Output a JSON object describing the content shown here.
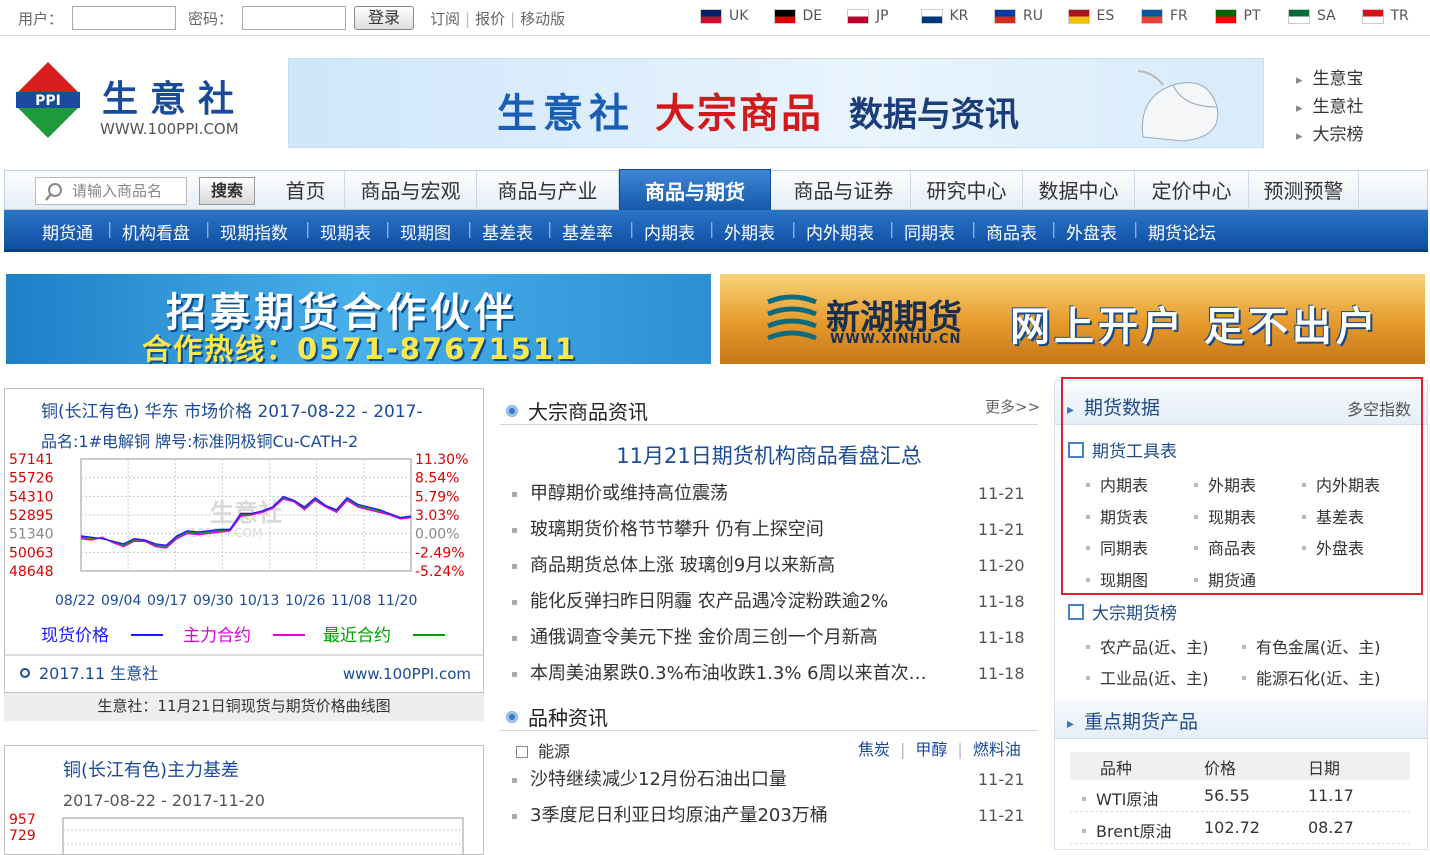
{
  "topbar": {
    "user_label": "用户：",
    "password_label": "密码：",
    "login_button": "登录",
    "links": [
      "订阅",
      "报价",
      "移动版"
    ],
    "languages": [
      {
        "code": "UK",
        "c1": "#012169",
        "c2": "#c8102e"
      },
      {
        "code": "DE",
        "c1": "#000000",
        "c2": "#dd0000"
      },
      {
        "code": "JP",
        "c1": "#ffffff",
        "c2": "#bc002d"
      },
      {
        "code": "KR",
        "c1": "#ffffff",
        "c2": "#003478"
      },
      {
        "code": "RU",
        "c1": "#0039a6",
        "c2": "#d52b1e"
      },
      {
        "code": "ES",
        "c1": "#aa151b",
        "c2": "#f1bf00"
      },
      {
        "code": "FR",
        "c1": "#0055a4",
        "c2": "#ef4135"
      },
      {
        "code": "PT",
        "c1": "#006600",
        "c2": "#ff0000"
      },
      {
        "code": "SA",
        "c1": "#006c35",
        "c2": "#ffffff"
      },
      {
        "code": "TR",
        "c1": "#e30a17",
        "c2": "#ffffff"
      }
    ]
  },
  "header": {
    "logo_text": "生意社",
    "logo_url": "WWW.100PPI.COM",
    "logo_badge": "PPI",
    "banner": {
      "part1": "生意社",
      "part2": "大宗商品",
      "part3": "数据与资讯"
    },
    "side_links": [
      "生意宝",
      "生意社",
      "大宗榜"
    ]
  },
  "nav": {
    "search_placeholder": "请输入商品名",
    "search_button": "搜索",
    "items": [
      "首页",
      "商品与宏观",
      "商品与产业",
      "商品与期货",
      "商品与证券",
      "研究中心",
      "数据中心",
      "定价中心",
      "预测预警"
    ],
    "active": "商品与期货",
    "subnav": [
      "期货通",
      "机构看盘",
      "现期指数",
      "现期表",
      "现期图",
      "基差表",
      "基差率",
      "内期表",
      "外期表",
      "内外期表",
      "同期表",
      "商品表",
      "外盘表",
      "期货论坛"
    ]
  },
  "ads": {
    "ad1_title": "招募期货合作伙伴",
    "ad1_phone": "合作热线：0571-87671511",
    "ad2_name": "新湖期货",
    "ad2_url": "WWW.XINHU.CN",
    "ad2_slogan": "网上开户 足不出户"
  },
  "left": {
    "chart1_caption": "生意社：11月21日铜现货与期货价格曲线图",
    "chart2_title": "铜(长江有色)主力基差",
    "chart2_range": "2017-08-22 - 2017-11-20",
    "chart2_ticks": [
      "957",
      "729"
    ]
  },
  "chart_data": {
    "type": "line",
    "title": "铜(长江有色) 华东 市场价格 2017-08-22 - 2017-",
    "subtitle": "品名:1#电解铜 牌号:标准阴极铜Cu-CATH-2",
    "y_ticks_left": [
      "57141",
      "55726",
      "54310",
      "52895",
      "51340",
      "50063",
      "48648"
    ],
    "y_ticks_right": [
      "11.30%",
      "8.54%",
      "5.79%",
      "3.03%",
      "0.00%",
      "-2.49%",
      "-5.24%"
    ],
    "x_ticks": [
      "08/22",
      "09/04",
      "09/17",
      "09/30",
      "10/13",
      "10/26",
      "11/08",
      "11/20"
    ],
    "ylim": [
      48648,
      57141
    ],
    "series": [
      {
        "name": "现货价格",
        "color": "#1a1aff",
        "values": [
          51300,
          51200,
          51100,
          50900,
          50700,
          51100,
          51000,
          50700,
          50600,
          51300,
          51700,
          51600,
          51700,
          51800,
          51800,
          53000,
          53000,
          53200,
          53500,
          54300,
          54000,
          53500,
          54200,
          53600,
          53300,
          54200,
          53700,
          53500,
          53300,
          53000,
          52700,
          52800
        ]
      },
      {
        "name": "主力合约",
        "color": "#e000e0",
        "values": [
          51100,
          51000,
          51200,
          50800,
          50500,
          50900,
          50900,
          50500,
          50400,
          51100,
          51500,
          51400,
          51500,
          51600,
          51700,
          52800,
          52900,
          53100,
          53400,
          54100,
          53900,
          53300,
          54000,
          53500,
          53100,
          54000,
          53500,
          53300,
          53100,
          52900,
          52600,
          52700
        ]
      },
      {
        "name": "最近合约",
        "color": "#00a000",
        "values": [
          51200,
          51100,
          51150,
          50850,
          50600,
          51000,
          50950,
          50600,
          50500,
          51200,
          51600,
          51500,
          51600,
          51700,
          51750,
          52900,
          52950,
          53150,
          53450,
          54200,
          53950,
          53400,
          54100,
          53550,
          53200,
          54100,
          53600,
          53400,
          53200,
          52950,
          52650,
          52750
        ]
      }
    ],
    "footer_left": "2017.11 生意社",
    "footer_right": "www.100PPI.com",
    "watermark": "生意社",
    "watermark_url": "100PPI.COM"
  },
  "middle": {
    "section1_title": "大宗商品资讯",
    "more": "更多>>",
    "headline": "11月21日期货机构商品看盘汇总",
    "news": [
      {
        "t": "甲醇期价或维持高位震荡",
        "d": "11-21"
      },
      {
        "t": "玻璃期货价格节节攀升 仍有上探空间",
        "d": "11-21"
      },
      {
        "t": "商品期货总体上涨 玻璃创9月以来新高",
        "d": "11-20"
      },
      {
        "t": "能化反弹扫昨日阴霾 农产品遇冷淀粉跌逾2%",
        "d": "11-18"
      },
      {
        "t": "通俄调查令美元下挫 金价周三创一个月新高",
        "d": "11-18"
      },
      {
        "t": "本周美油累跌0.3%布油收跌1.3% 6周以来首次周跌",
        "d": "11-18"
      }
    ],
    "section2_title": "品种资讯",
    "cat_label": "能源",
    "cat_links": [
      "焦炭",
      "甲醇",
      "燃料油"
    ],
    "news2": [
      {
        "t": "沙特继续减少12月份石油出口量",
        "d": "11-21"
      },
      {
        "t": "3季度尼日利亚日均原油产量203万桶",
        "d": "11-21"
      }
    ]
  },
  "right": {
    "head1": "期货数据",
    "head1_right": "多空指数",
    "tools_title": "期货工具表",
    "tools": [
      "内期表",
      "外期表",
      "内外期表",
      "期货表",
      "现期表",
      "基差表",
      "同期表",
      "商品表",
      "外盘表",
      "现期图",
      "期货通"
    ],
    "rank_title": "大宗期货榜",
    "ranks": [
      "农产品(近、主)",
      "有色金属(近、主)",
      "工业品(近、主)",
      "能源石化(近、主)"
    ],
    "head2": "重点期货产品",
    "table_headers": [
      "品种",
      "价格",
      "日期"
    ],
    "table_rows": [
      [
        "WTI原油",
        "56.55",
        "11.17"
      ],
      [
        "Brent原油",
        "102.72",
        "08.27"
      ]
    ]
  }
}
